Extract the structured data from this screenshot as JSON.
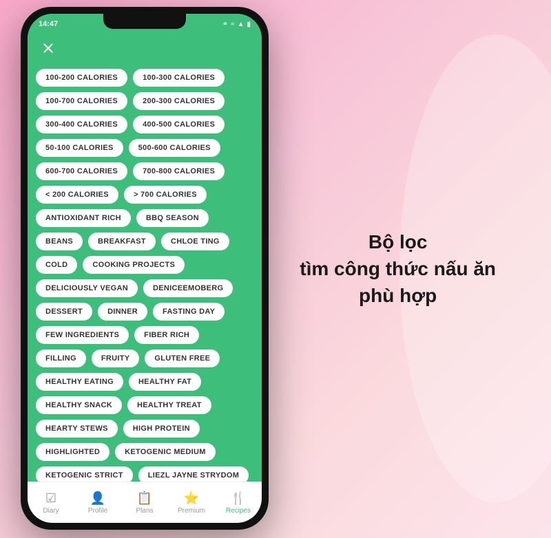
{
  "background": {
    "gradient_start": "#f9a8c9",
    "gradient_end": "#fce4ec"
  },
  "right_text": {
    "line1": "Bộ lọc",
    "line2": "tìm công thức nấu ăn",
    "line3": "phù hợp"
  },
  "phone": {
    "status_bar": {
      "time": "14:47",
      "icons": "bluetooth wifi signal battery"
    },
    "close_button_label": "×",
    "tags": [
      "100-200 CALORIES",
      "100-300 CALORIES",
      "100-700 CALORIES",
      "200-300 CALORIES",
      "300-400 CALORIES",
      "400-500 CALORIES",
      "50-100 CALORIES",
      "500-600 CALORIES",
      "600-700 CALORIES",
      "700-800 CALORIES",
      "< 200 CALORIES",
      "> 700 CALORIES",
      "ANTIOXIDANT RICH",
      "BBQ SEASON",
      "BEANS",
      "BREAKFAST",
      "CHLOE TING",
      "COLD",
      "COOKING PROJECTS",
      "DELICIOUSLY VEGAN",
      "DENICEEMOBERG",
      "DESSERT",
      "DINNER",
      "FASTING DAY",
      "FEW INGREDIENTS",
      "FIBER RICH",
      "FILLING",
      "FRUITY",
      "GLUTEN FREE",
      "HEALTHY EATING",
      "HEALTHY FAT",
      "HEALTHY SNACK",
      "HEALTHY TREAT",
      "HEARTY STEWS",
      "HIGH PROTEIN",
      "HIGHLIGHTED",
      "KETOGENIC MEDIUM",
      "KETOGENIC STRICT",
      "LIEZL JAYNE STRYDOM"
    ],
    "bottom_nav": [
      {
        "label": "Diary",
        "icon": "☑",
        "active": false
      },
      {
        "label": "Profile",
        "icon": "👤",
        "active": false
      },
      {
        "label": "Plans",
        "icon": "📋",
        "active": false
      },
      {
        "label": "Premium",
        "icon": "⭐",
        "active": false
      },
      {
        "label": "Recipes",
        "icon": "🍴",
        "active": true
      }
    ]
  }
}
